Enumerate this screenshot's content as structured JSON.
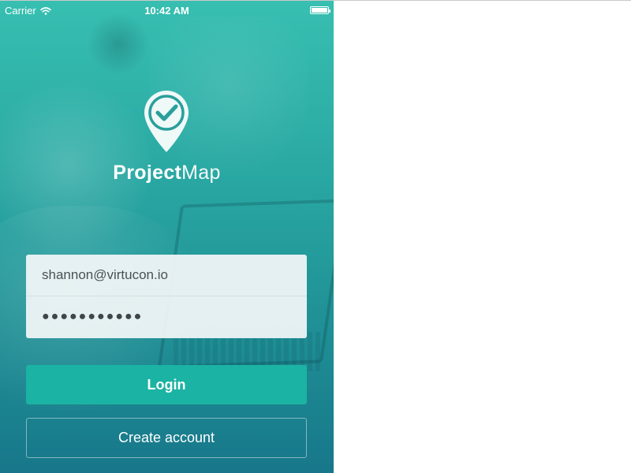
{
  "status_bar": {
    "carrier": "Carrier",
    "time": "10:42 AM",
    "wifi_icon": "wifi-icon",
    "battery_icon": "battery-full-icon"
  },
  "app": {
    "logo_icon": "map-pin-checkmark-icon",
    "name_bold": "Project",
    "name_light": "Map"
  },
  "login_form": {
    "email_value": "shannon@virtucon.io",
    "password_mask": "●●●●●●●●●●●",
    "login_label": "Login",
    "create_account_label": "Create account"
  },
  "colors": {
    "accent": "#1bb3a3",
    "background_top": "#37bfb1",
    "background_bottom": "#17778a",
    "form_background": "#f0f5f6",
    "text_primary": "#4b5054"
  }
}
